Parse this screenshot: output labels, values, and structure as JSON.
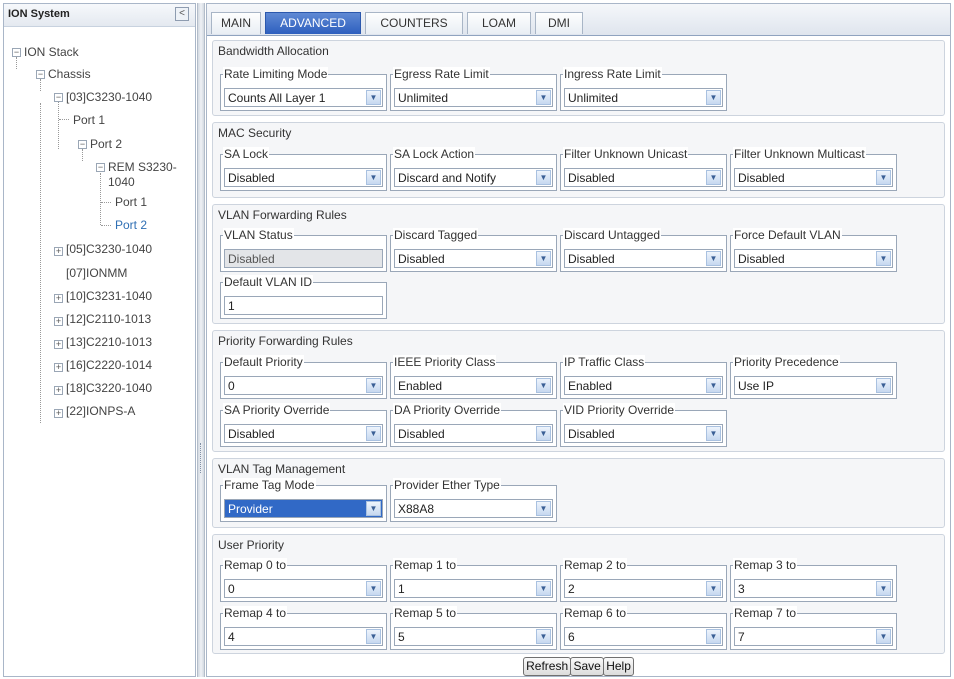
{
  "tree": {
    "title": "ION System",
    "collapse_glyph": "<",
    "nodes": {
      "ion_stack": "ION Stack",
      "chassis": "Chassis",
      "m03": "[03]C3230-1040",
      "m03_port1": "Port 1",
      "m03_port2": "Port 2",
      "rem_line1": "REM S3230-",
      "rem_line2": "1040",
      "rem_port1": "Port 1",
      "rem_port2": "Port 2",
      "m05": "[05]C3230-1040",
      "m07": "[07]IONMM",
      "m10": "[10]C3231-1040",
      "m12": "[12]C2110-1013",
      "m13": "[13]C2210-1013",
      "m16": "[16]C2220-1014",
      "m18": "[18]C3220-1040",
      "m22": "[22]IONPS-A"
    },
    "selected": "Port 2",
    "selected_color": "#2f6fb4"
  },
  "tabs": [
    "MAIN",
    "ADVANCED",
    "COUNTERS",
    "LOAM",
    "DMI"
  ],
  "active_tab": "ADVANCED",
  "accent_color": "#2d5fbe",
  "sections": {
    "bandwidth": {
      "title": "Bandwidth Allocation",
      "fields": [
        {
          "label": "Rate Limiting Mode",
          "value": "Counts All Layer 1"
        },
        {
          "label": "Egress Rate Limit",
          "value": "Unlimited"
        },
        {
          "label": "Ingress Rate Limit",
          "value": "Unlimited"
        }
      ]
    },
    "mac": {
      "title": "MAC Security",
      "fields": [
        {
          "label": "SA Lock",
          "value": "Disabled"
        },
        {
          "label": "SA Lock Action",
          "value": "Discard and Notify"
        },
        {
          "label": "Filter Unknown Unicast",
          "value": "Disabled"
        },
        {
          "label": "Filter Unknown Multicast",
          "value": "Disabled"
        }
      ]
    },
    "vlan_fwd": {
      "title": "VLAN Forwarding Rules",
      "fields": [
        {
          "label": "VLAN Status",
          "value": "Disabled"
        },
        {
          "label": "Discard Tagged",
          "value": "Disabled"
        },
        {
          "label": "Discard Untagged",
          "value": "Disabled"
        },
        {
          "label": "Force Default VLAN",
          "value": "Disabled"
        },
        {
          "label": "Default VLAN ID",
          "value": "1"
        }
      ]
    },
    "priority": {
      "title": "Priority Forwarding Rules",
      "fields": [
        {
          "label": "Default Priority",
          "value": "0"
        },
        {
          "label": "IEEE Priority Class",
          "value": "Enabled"
        },
        {
          "label": "IP Traffic Class",
          "value": "Enabled"
        },
        {
          "label": "Priority Precedence",
          "value": "Use IP"
        },
        {
          "label": "SA Priority Override",
          "value": "Disabled"
        },
        {
          "label": "DA Priority Override",
          "value": "Disabled"
        },
        {
          "label": "VID Priority Override",
          "value": "Disabled"
        }
      ]
    },
    "vlan_tag": {
      "title": "VLAN Tag Management",
      "fields": [
        {
          "label": "Frame Tag Mode",
          "value": "Provider"
        },
        {
          "label": "Provider Ether Type",
          "value": "X88A8"
        }
      ]
    },
    "user_priority": {
      "title": "User Priority",
      "fields": [
        {
          "label": "Remap 0 to",
          "value": "0"
        },
        {
          "label": "Remap 1 to",
          "value": "1"
        },
        {
          "label": "Remap 2 to",
          "value": "2"
        },
        {
          "label": "Remap 3 to",
          "value": "3"
        },
        {
          "label": "Remap 4 to",
          "value": "4"
        },
        {
          "label": "Remap 5 to",
          "value": "5"
        },
        {
          "label": "Remap 6 to",
          "value": "6"
        },
        {
          "label": "Remap 7 to",
          "value": "7"
        }
      ]
    }
  },
  "buttons": {
    "refresh": "Refresh",
    "save": "Save",
    "help": "Help"
  }
}
